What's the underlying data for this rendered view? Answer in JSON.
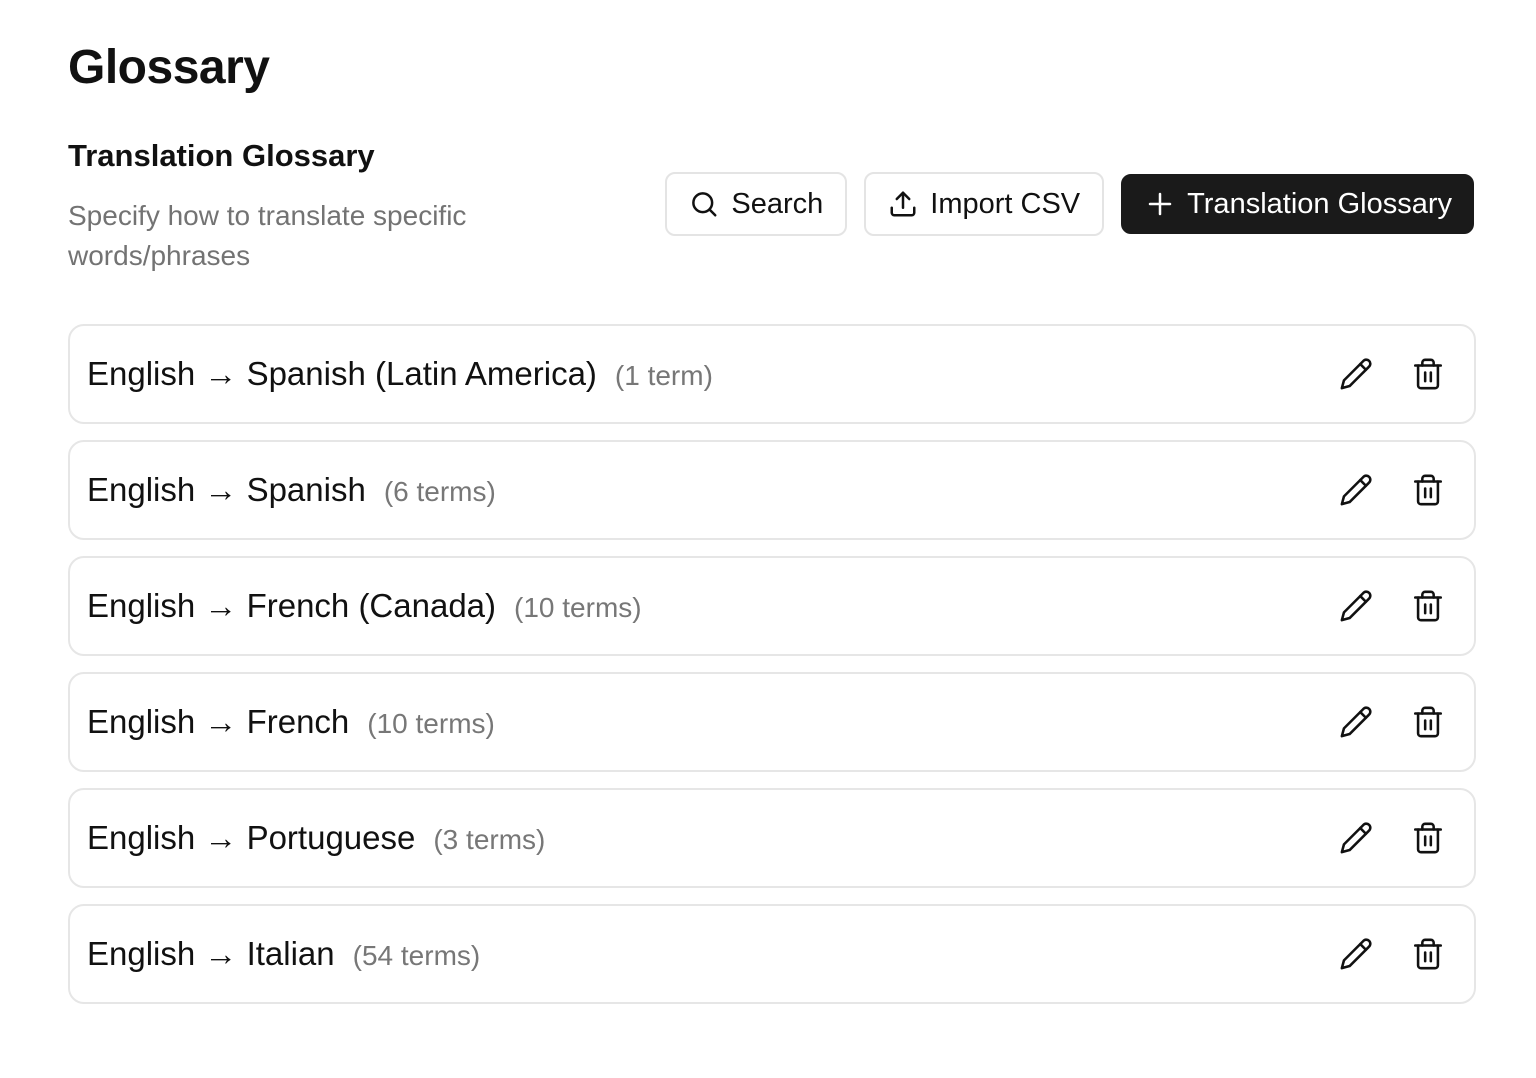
{
  "page": {
    "title": "Glossary"
  },
  "section": {
    "title": "Translation Glossary",
    "description": "Specify how to translate specific words/phrases"
  },
  "toolbar": {
    "search_label": "Search",
    "search_icon": "search-icon",
    "import_label": "Import CSV",
    "import_icon": "upload-icon",
    "add_label": "Translation Glossary",
    "add_icon": "plus-icon"
  },
  "glossaries": [
    {
      "name": "English → Spanish (Latin America)",
      "count": "(1 term)"
    },
    {
      "name": "English → Spanish",
      "count": "(6 terms)"
    },
    {
      "name": "English → French (Canada)",
      "count": "(10 terms)"
    },
    {
      "name": "English → French",
      "count": "(10 terms)"
    },
    {
      "name": "English → Portuguese",
      "count": "(3 terms)"
    },
    {
      "name": "English → Italian",
      "count": "(54 terms)"
    }
  ],
  "row_actions": {
    "edit_icon": "pencil-icon",
    "delete_icon": "trash-icon"
  },
  "colors": {
    "primary_button_bg": "#1a1a1a",
    "border": "#e6e6e6",
    "muted_text": "#737373"
  }
}
